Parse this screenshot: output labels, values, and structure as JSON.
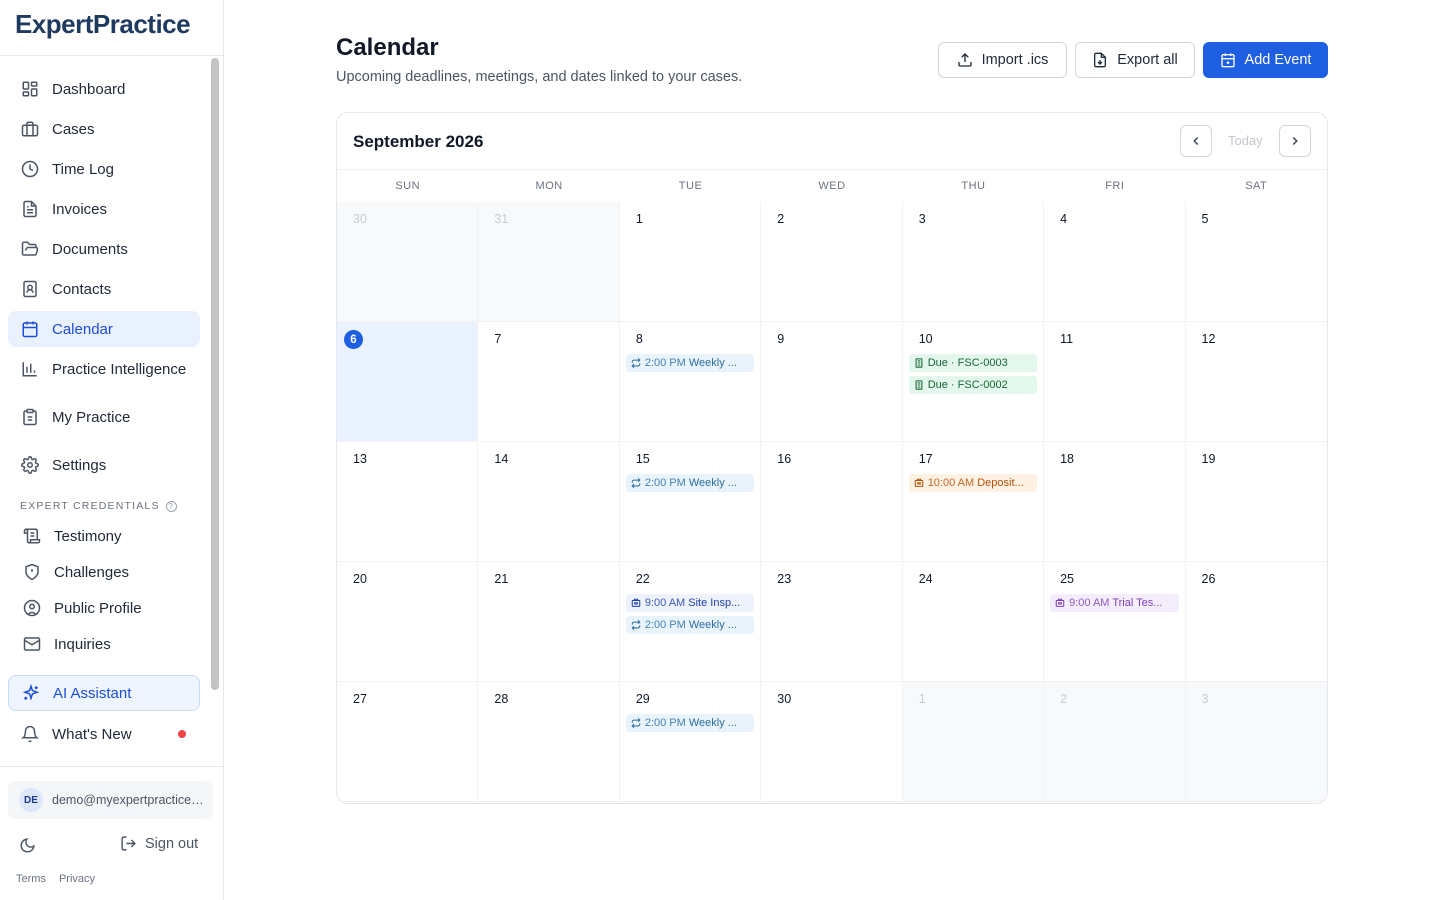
{
  "brand": {
    "name": "ExpertPractice"
  },
  "sidebar": {
    "items": [
      {
        "label": "Dashboard",
        "icon": "dashboard-icon"
      },
      {
        "label": "Cases",
        "icon": "briefcase-icon"
      },
      {
        "label": "Time Log",
        "icon": "clock-icon"
      },
      {
        "label": "Invoices",
        "icon": "invoice-icon"
      },
      {
        "label": "Documents",
        "icon": "folder-icon"
      },
      {
        "label": "Contacts",
        "icon": "contact-book-icon"
      },
      {
        "label": "Calendar",
        "icon": "calendar-icon",
        "active": true
      },
      {
        "label": "Practice Intelligence",
        "icon": "bar-chart-icon"
      },
      {
        "label": "My Practice",
        "icon": "clipboard-icon"
      },
      {
        "label": "Settings",
        "icon": "gear-icon"
      }
    ],
    "credentials_label": "EXPERT CREDENTIALS",
    "credentials": [
      {
        "label": "Testimony",
        "icon": "scroll-icon"
      },
      {
        "label": "Challenges",
        "icon": "shield-icon"
      },
      {
        "label": "Public Profile",
        "icon": "user-circle-icon"
      },
      {
        "label": "Inquiries",
        "icon": "mail-icon"
      }
    ],
    "ai_assistant": "AI Assistant",
    "whats_new": "What's New",
    "user_initials": "DE",
    "user_email": "demo@myexpertpractice.com",
    "sign_out": "Sign out",
    "terms": "Terms",
    "privacy": "Privacy"
  },
  "header": {
    "title": "Calendar",
    "subtitle": "Upcoming deadlines, meetings, and dates linked to your cases.",
    "import_label": "Import .ics",
    "export_label": "Export all",
    "add_label": "Add Event"
  },
  "calendar": {
    "month": "September 2026",
    "today_label": "Today",
    "weekdays": [
      "SUN",
      "MON",
      "TUE",
      "WED",
      "THU",
      "FRI",
      "SAT"
    ],
    "weeks": [
      [
        {
          "d": "30",
          "other": true
        },
        {
          "d": "31",
          "other": true
        },
        {
          "d": "1"
        },
        {
          "d": "2"
        },
        {
          "d": "3"
        },
        {
          "d": "4"
        },
        {
          "d": "5"
        }
      ],
      [
        {
          "d": "6",
          "today": true
        },
        {
          "d": "7"
        },
        {
          "d": "8",
          "events": [
            {
              "type": "blue",
              "icon": "repeat",
              "time": "2:00 PM",
              "title": "Weekly ..."
            }
          ]
        },
        {
          "d": "9"
        },
        {
          "d": "10",
          "events": [
            {
              "type": "green",
              "icon": "doc",
              "time": "",
              "title": "Due · FSC-0003"
            },
            {
              "type": "green",
              "icon": "doc",
              "time": "",
              "title": "Due · FSC-0002"
            }
          ]
        },
        {
          "d": "11"
        },
        {
          "d": "12"
        }
      ],
      [
        {
          "d": "13"
        },
        {
          "d": "14"
        },
        {
          "d": "15",
          "events": [
            {
              "type": "blue",
              "icon": "repeat",
              "time": "2:00 PM",
              "title": "Weekly ..."
            }
          ]
        },
        {
          "d": "16"
        },
        {
          "d": "17",
          "events": [
            {
              "type": "orange",
              "icon": "building",
              "time": "10:00 AM",
              "title": "Deposit..."
            }
          ]
        },
        {
          "d": "18"
        },
        {
          "d": "19"
        }
      ],
      [
        {
          "d": "20"
        },
        {
          "d": "21"
        },
        {
          "d": "22",
          "events": [
            {
              "type": "siteblue",
              "icon": "building",
              "time": "9:00 AM",
              "title": "Site Insp..."
            },
            {
              "type": "blue",
              "icon": "repeat",
              "time": "2:00 PM",
              "title": "Weekly ..."
            }
          ]
        },
        {
          "d": "23"
        },
        {
          "d": "24"
        },
        {
          "d": "25",
          "events": [
            {
              "type": "purple",
              "icon": "building",
              "time": "9:00 AM",
              "title": "Trial Tes..."
            }
          ]
        },
        {
          "d": "26"
        }
      ],
      [
        {
          "d": "27"
        },
        {
          "d": "28"
        },
        {
          "d": "29",
          "events": [
            {
              "type": "blue",
              "icon": "repeat",
              "time": "2:00 PM",
              "title": "Weekly ..."
            }
          ]
        },
        {
          "d": "30"
        },
        {
          "d": "1",
          "other": true
        },
        {
          "d": "2",
          "other": true
        },
        {
          "d": "3",
          "other": true
        }
      ]
    ]
  }
}
